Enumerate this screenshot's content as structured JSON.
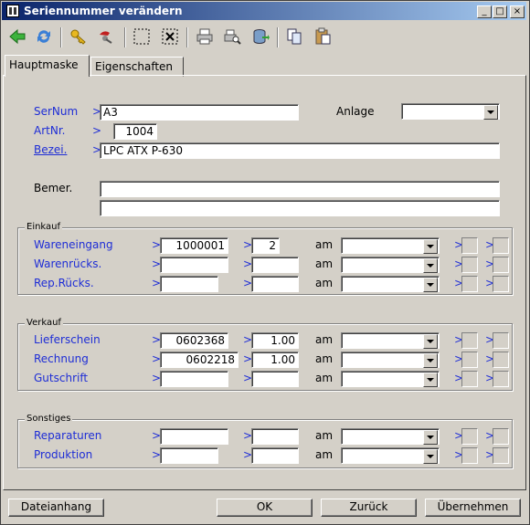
{
  "window": {
    "title": "Seriennummer verändern",
    "min": "_",
    "max": "□",
    "close": "×"
  },
  "toolbar": {
    "icons": [
      "back-arrow-icon",
      "refresh-icon",
      "key-icon",
      "tools-icon",
      "select-frame-icon",
      "delete-frame-icon",
      "print-icon",
      "print-preview-icon",
      "export-icon",
      "copy-icon",
      "paste-icon"
    ]
  },
  "tabs": {
    "main": "Hauptmaske",
    "props": "Eigenschaften"
  },
  "arrow": ">",
  "fields": {
    "sernum_label": "SerNum",
    "sernum_value": "A3",
    "anlage_label": "Anlage",
    "anlage_value": "",
    "artnr_label": "ArtNr.",
    "artnr_value": "1004",
    "bezei_label": "Bezei.",
    "bezei_value": "LPC ATX P-630",
    "bemer_label": "Bemer.",
    "bemer_line1": "",
    "bemer_line2": ""
  },
  "am": "am",
  "einkauf": {
    "title": "Einkauf",
    "rows": [
      {
        "label": "Wareneingang",
        "num": "1000001",
        "qty": "2"
      },
      {
        "label": "Warenrücks.",
        "num": "",
        "qty": ""
      },
      {
        "label": "Rep.Rücks.",
        "num": "",
        "qty": ""
      }
    ]
  },
  "verkauf": {
    "title": "Verkauf",
    "rows": [
      {
        "label": "Lieferschein",
        "num": "0602368",
        "qty": "1.00"
      },
      {
        "label": "Rechnung",
        "num": "0602218",
        "qty": "1.00"
      },
      {
        "label": "Gutschrift",
        "num": "",
        "qty": ""
      }
    ]
  },
  "sonstiges": {
    "title": "Sonstiges",
    "rows": [
      {
        "label": "Reparaturen",
        "num": "",
        "qty": ""
      },
      {
        "label": "Produktion",
        "num": "",
        "qty": ""
      }
    ]
  },
  "buttons": {
    "attach": "Dateianhang",
    "ok": "OK",
    "back": "Zurück",
    "apply": "Übernehmen"
  }
}
